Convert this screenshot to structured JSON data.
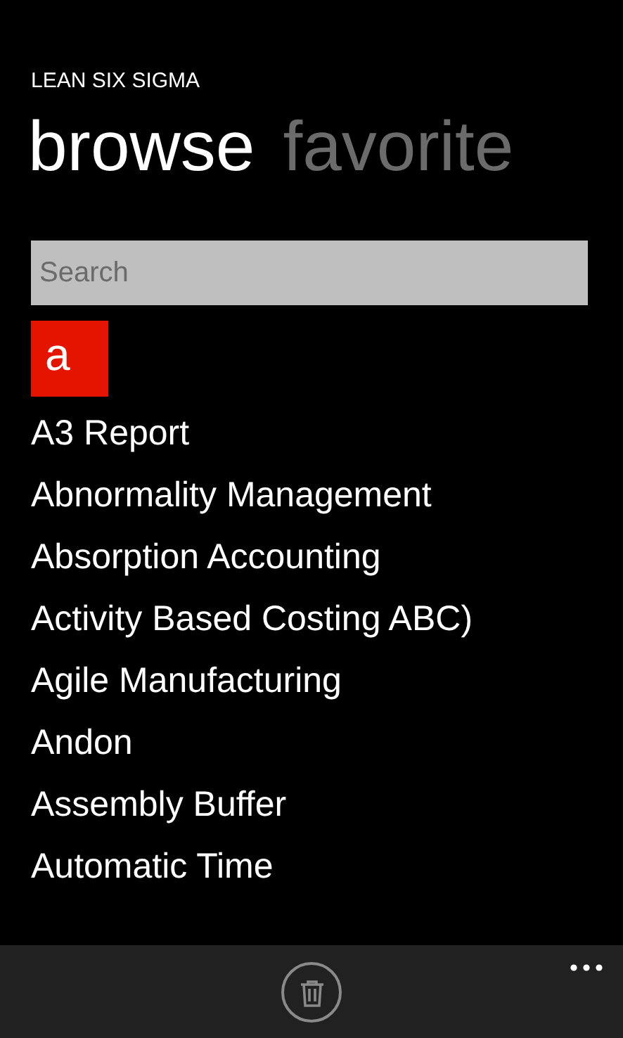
{
  "app_title": "LEAN SIX SIGMA",
  "tabs": [
    {
      "label": "browse",
      "selected": true
    },
    {
      "label": "favorite",
      "selected": false
    }
  ],
  "search": {
    "placeholder": "Search"
  },
  "groups": [
    {
      "letter": "a",
      "items": [
        "A3 Report",
        "Abnormality Management",
        "Absorption Accounting",
        "Activity Based Costing ABC)",
        "Agile Manufacturing",
        "Andon",
        "Assembly Buffer",
        "Automatic Time"
      ]
    }
  ],
  "app_bar": {
    "delete_button": {
      "disabled": true
    }
  }
}
